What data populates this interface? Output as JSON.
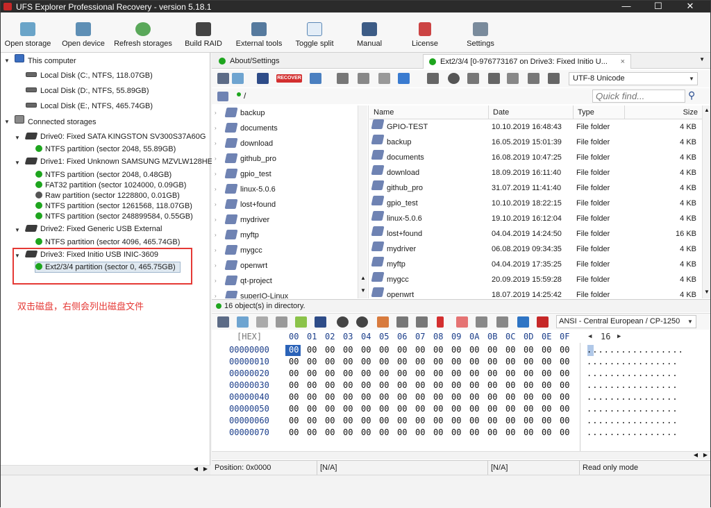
{
  "window": {
    "title": "UFS Explorer Professional Recovery - version 5.18.1",
    "minimize": "—",
    "maximize": "☐",
    "close": "✕"
  },
  "toolbar": [
    "Open storage",
    "Open device",
    "Refresh storages",
    "Build RAID",
    "External tools",
    "Toggle split",
    "Manual",
    "License",
    "Settings"
  ],
  "tree": {
    "this_computer": "This computer",
    "local_disks": [
      "Local Disk (C:, NTFS, 118.07GB)",
      "Local Disk (D:, NTFS, 55.89GB)",
      "Local Disk (E:, NTFS, 465.74GB)"
    ],
    "connected": "Connected storages",
    "drive0": "Drive0: Fixed SATA KINGSTON SV300S37A60G",
    "drive0_parts": [
      "NTFS partition (sector 2048, 55.89GB)"
    ],
    "drive1": "Drive1: Fixed Unknown SAMSUNG MZVLW128HEGR",
    "drive1_parts": [
      "NTFS partition (sector 2048, 0.48GB)",
      "FAT32 partition (sector 1024000, 0.09GB)",
      "Raw partition (sector 1228800, 0.01GB)",
      "NTFS partition (sector 1261568, 118.07GB)",
      "NTFS partition (sector 248899584, 0.55GB)"
    ],
    "drive2": "Drive2: Fixed Generic USB External",
    "drive2_parts": [
      "NTFS partition (sector 4096, 465.74GB)"
    ],
    "drive3": "Drive3: Fixed Initio USB INIC-3609",
    "drive3_parts": [
      "Ext2/3/4 partition (sector 0, 465.75GB)"
    ]
  },
  "annotation": "双击磁盘，右侧会列出磁盘文件",
  "tabs": [
    "About/Settings",
    "Ext2/3/4 [0-976773167 on Drive3: Fixed Initio U..."
  ],
  "tab_close": "×",
  "recover_label": "RECOVER",
  "encoding": "UTF-8 Unicode",
  "path": "/",
  "quick_find_placeholder": "Quick find...",
  "folder_tree": [
    "backup",
    "documents",
    "download",
    "github_pro",
    "gpio_test",
    "linux-5.0.6",
    "lost+found",
    "mydriver",
    "myftp",
    "mygcc",
    "openwrt",
    "qt-project",
    "superIO-Linux"
  ],
  "file_columns": [
    "Name",
    "Date",
    "Type",
    "Size"
  ],
  "files": [
    {
      "name": "GPIO-TEST",
      "date": "10.10.2019 16:48:43",
      "type": "File folder",
      "size": "4 KB"
    },
    {
      "name": "backup",
      "date": "16.05.2019 15:01:39",
      "type": "File folder",
      "size": "4 KB"
    },
    {
      "name": "documents",
      "date": "16.08.2019 10:47:25",
      "type": "File folder",
      "size": "4 KB"
    },
    {
      "name": "download",
      "date": "18.09.2019 16:11:40",
      "type": "File folder",
      "size": "4 KB"
    },
    {
      "name": "github_pro",
      "date": "31.07.2019 11:41:40",
      "type": "File folder",
      "size": "4 KB"
    },
    {
      "name": "gpio_test",
      "date": "10.10.2019 18:22:15",
      "type": "File folder",
      "size": "4 KB"
    },
    {
      "name": "linux-5.0.6",
      "date": "19.10.2019 16:12:04",
      "type": "File folder",
      "size": "4 KB"
    },
    {
      "name": "lost+found",
      "date": "04.04.2019 14:24:50",
      "type": "File folder",
      "size": "16 KB"
    },
    {
      "name": "mydriver",
      "date": "06.08.2019 09:34:35",
      "type": "File folder",
      "size": "4 KB"
    },
    {
      "name": "myftp",
      "date": "04.04.2019 17:35:25",
      "type": "File folder",
      "size": "4 KB"
    },
    {
      "name": "mygcc",
      "date": "20.09.2019 15:59:28",
      "type": "File folder",
      "size": "4 KB"
    },
    {
      "name": "openwrt",
      "date": "18.07.2019 14:25:42",
      "type": "File folder",
      "size": "4 KB"
    }
  ],
  "status": "16 object(s) in directory.",
  "hex_encoding": "ANSI - Central European / CP-1250",
  "hex": {
    "label": "[HEX]",
    "columns": [
      "00",
      "01",
      "02",
      "03",
      "04",
      "05",
      "06",
      "07",
      "08",
      "09",
      "0A",
      "0B",
      "0C",
      "0D",
      "0E",
      "0F"
    ],
    "width": "16",
    "offsets": [
      "00000000",
      "00000010",
      "00000020",
      "00000030",
      "00000040",
      "00000050",
      "00000060",
      "00000070"
    ],
    "byte": "00",
    "ascii_first": ".................",
    "ascii_rest": "................"
  },
  "bottom": {
    "position": "Position: 0x0000",
    "na1": "[N/A]",
    "na2": "[N/A]",
    "mode": "Read only mode"
  }
}
